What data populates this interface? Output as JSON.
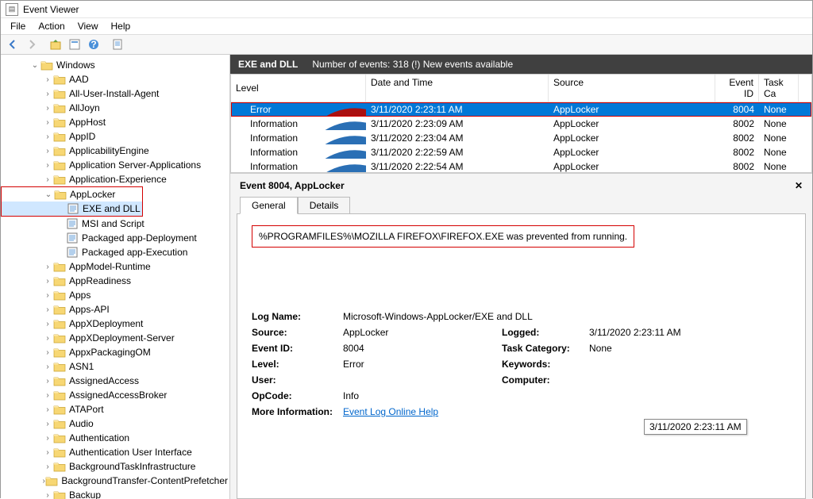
{
  "window": {
    "title": "Event Viewer"
  },
  "menu": {
    "file": "File",
    "action": "Action",
    "view": "View",
    "help": "Help"
  },
  "tree": {
    "root": "Windows",
    "folders": [
      "AAD",
      "All-User-Install-Agent",
      "AllJoyn",
      "AppHost",
      "AppID",
      "ApplicabilityEngine",
      "Application Server-Applications",
      "Application-Experience"
    ],
    "applocker": {
      "name": "AppLocker",
      "children": [
        "EXE and DLL",
        "MSI and Script",
        "Packaged app-Deployment",
        "Packaged app-Execution"
      ]
    },
    "folders2": [
      "AppModel-Runtime",
      "AppReadiness",
      "Apps",
      "Apps-API",
      "AppXDeployment",
      "AppXDeployment-Server",
      "AppxPackagingOM",
      "ASN1",
      "AssignedAccess",
      "AssignedAccessBroker",
      "ATAPort",
      "Audio",
      "Authentication",
      "Authentication User Interface",
      "BackgroundTaskInfrastructure",
      "BackgroundTransfer-ContentPrefetcher",
      "Backup"
    ]
  },
  "header": {
    "title": "EXE and DLL",
    "count": "Number of events: 318 (!) New events available"
  },
  "cols": {
    "level": "Level",
    "date": "Date and Time",
    "source": "Source",
    "eid": "Event ID",
    "cat": "Task Ca"
  },
  "events": [
    {
      "level": "Error",
      "date": "3/11/2020 2:23:11 AM",
      "source": "AppLocker",
      "eid": "8004",
      "cat": "None",
      "sel": true
    },
    {
      "level": "Information",
      "date": "3/11/2020 2:23:09 AM",
      "source": "AppLocker",
      "eid": "8002",
      "cat": "None"
    },
    {
      "level": "Information",
      "date": "3/11/2020 2:23:04 AM",
      "source": "AppLocker",
      "eid": "8002",
      "cat": "None"
    },
    {
      "level": "Information",
      "date": "3/11/2020 2:22:59 AM",
      "source": "AppLocker",
      "eid": "8002",
      "cat": "None"
    },
    {
      "level": "Information",
      "date": "3/11/2020 2:22:54 AM",
      "source": "AppLocker",
      "eid": "8002",
      "cat": "None"
    }
  ],
  "detail": {
    "title": "Event 8004, AppLocker",
    "tabs": {
      "general": "General",
      "details": "Details"
    },
    "message": "%PROGRAMFILES%\\MOZILLA FIREFOX\\FIREFOX.EXE was prevented from running.",
    "props": {
      "logname_k": "Log Name:",
      "logname_v": "Microsoft-Windows-AppLocker/EXE and DLL",
      "source_k": "Source:",
      "source_v": "AppLocker",
      "logged_k": "Logged:",
      "logged_v": "3/11/2020 2:23:11 AM",
      "eid_k": "Event ID:",
      "eid_v": "8004",
      "cat_k": "Task Category:",
      "cat_v": "None",
      "level_k": "Level:",
      "level_v": "Error",
      "kw_k": "Keywords:",
      "kw_v": "",
      "user_k": "User:",
      "user_v": "",
      "comp_k": "Computer:",
      "comp_v": "",
      "op_k": "OpCode:",
      "op_v": "Info",
      "more_k": "More Information:",
      "more_v": "Event Log Online Help"
    }
  },
  "tooltip": "3/11/2020 2:23:11 AM"
}
